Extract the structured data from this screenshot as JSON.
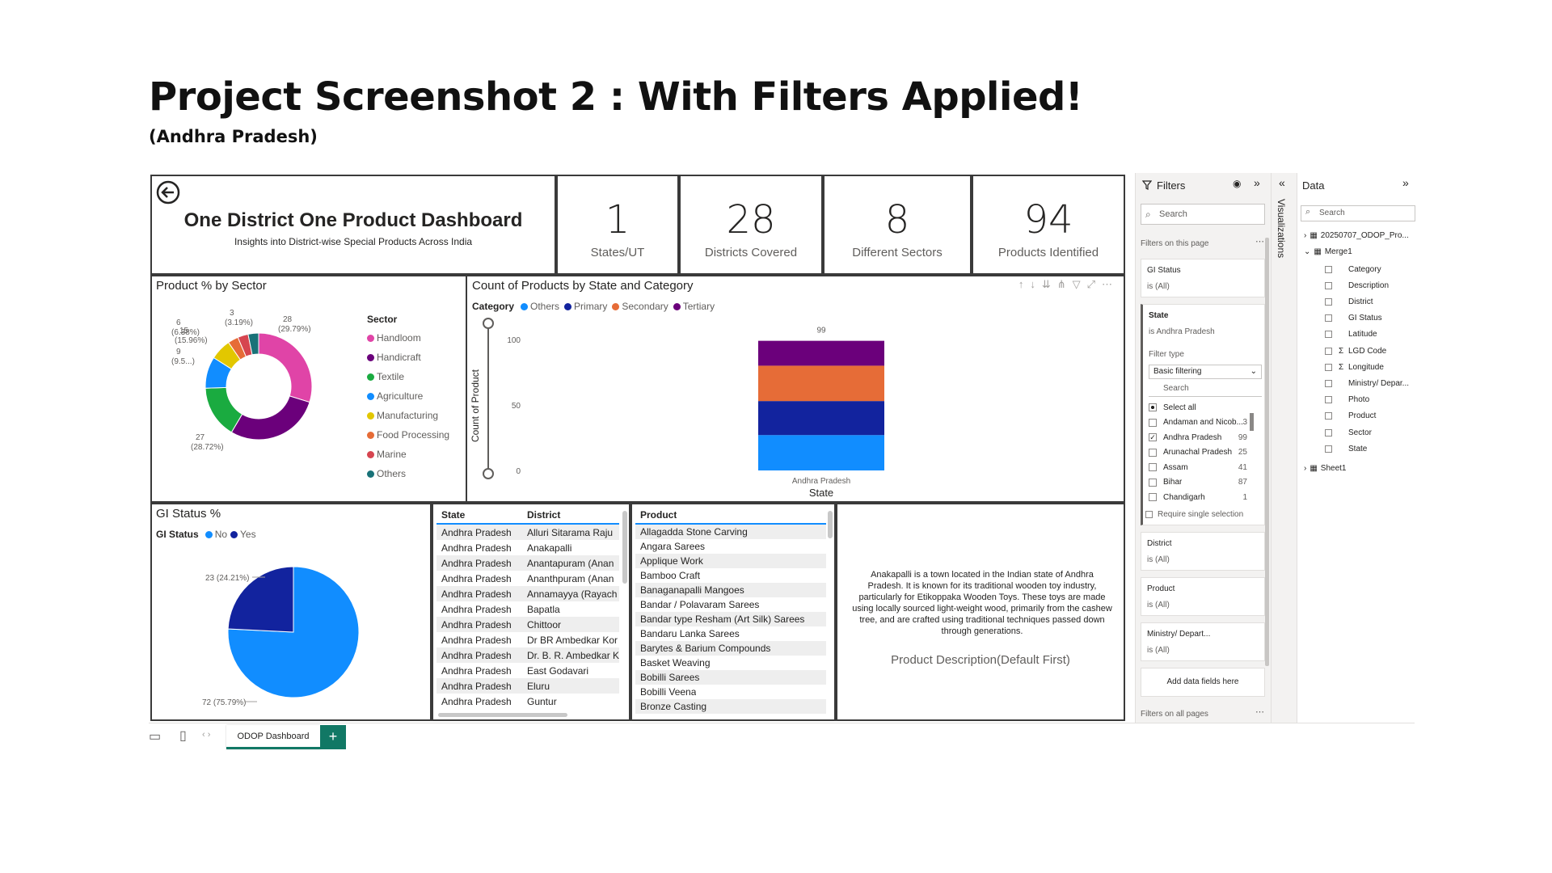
{
  "slide": {
    "title": "Project Screenshot 2 : With Filters Applied!",
    "subtitle": "(Andhra Pradesh)"
  },
  "header": {
    "title": "One District One Product Dashboard",
    "subtitle": "Insights into District-wise Special Products Across India"
  },
  "kpis": [
    {
      "value": "1",
      "label": "States/UT"
    },
    {
      "value": "28",
      "label": "Districts Covered"
    },
    {
      "value": "8",
      "label": "Different Sectors"
    },
    {
      "value": "94",
      "label": "Products Identified"
    }
  ],
  "chart_data": [
    {
      "type": "pie",
      "title": "Product % by Sector",
      "legend_title": "Sector",
      "legend_position": "right",
      "slices": [
        {
          "name": "Handloom",
          "value": 28,
          "label": "28 (29.79%)",
          "color": "#e044a7"
        },
        {
          "name": "Handicraft",
          "value": 27,
          "label": "27 (28.72%)",
          "color": "#6b007b"
        },
        {
          "name": "Textile",
          "value": 15,
          "label": "15 (15.96%)",
          "color": "#1aab40"
        },
        {
          "name": "Agriculture",
          "value": 9,
          "label": "9 (9.5...)",
          "color": "#118dff"
        },
        {
          "name": "Manufacturing",
          "value": 6,
          "label": "6 (6.38%)",
          "color": "#e2c700"
        },
        {
          "name": "Food Processing",
          "value": 3,
          "label": "3 (3.19%)",
          "color": "#e66c37"
        },
        {
          "name": "Marine",
          "value": 3,
          "label": "",
          "color": "#d64550"
        },
        {
          "name": "Others",
          "value": 3,
          "label": "",
          "color": "#197278"
        }
      ]
    },
    {
      "type": "bar",
      "title": "Count of Products by State and Category",
      "legend_title": "Category",
      "xlabel": "State",
      "ylabel": "Count of Product",
      "categories": [
        "Andhra Pradesh"
      ],
      "ylim": [
        0,
        100
      ],
      "yticks": [
        "0",
        "50",
        "100"
      ],
      "total_label": "99",
      "series": [
        {
          "name": "Others",
          "values": [
            27
          ],
          "color": "#118dff"
        },
        {
          "name": "Primary",
          "values": [
            26
          ],
          "color": "#12239e"
        },
        {
          "name": "Secondary",
          "values": [
            27
          ],
          "color": "#e66c37"
        },
        {
          "name": "Tertiary",
          "values": [
            19
          ],
          "color": "#6b007b"
        }
      ]
    },
    {
      "type": "pie",
      "title": "GI Status %",
      "legend_title": "GI Status",
      "legend_position": "top-left",
      "slices": [
        {
          "name": "No",
          "value": 72,
          "label": "72 (75.79%)",
          "color": "#118dff"
        },
        {
          "name": "Yes",
          "value": 23,
          "label": "23 (24.21%)",
          "color": "#12239e"
        }
      ]
    }
  ],
  "state_table": {
    "headers": [
      "State",
      "District"
    ],
    "rows": [
      [
        "Andhra Pradesh",
        "Alluri Sitarama Raju"
      ],
      [
        "Andhra Pradesh",
        "Anakapalli"
      ],
      [
        "Andhra Pradesh",
        "Anantapuram (Anan"
      ],
      [
        "Andhra Pradesh",
        "Ananthpuram (Anan"
      ],
      [
        "Andhra Pradesh",
        "Annamayya (Rayach"
      ],
      [
        "Andhra Pradesh",
        "Bapatla"
      ],
      [
        "Andhra Pradesh",
        "Chittoor"
      ],
      [
        "Andhra Pradesh",
        "Dr BR Ambedkar Kor"
      ],
      [
        "Andhra Pradesh",
        "Dr. B. R. Ambedkar K"
      ],
      [
        "Andhra Pradesh",
        "East Godavari"
      ],
      [
        "Andhra Pradesh",
        "Eluru"
      ],
      [
        "Andhra Pradesh",
        "Guntur"
      ]
    ]
  },
  "product_table": {
    "header": "Product",
    "rows": [
      "Allagadda Stone Carving",
      "Angara Sarees",
      "Applique Work",
      "Bamboo Craft",
      "Banaganapalli Mangoes",
      "Bandar / Polavaram Sarees",
      "Bandar type Resham (Art Silk) Sarees",
      "Bandaru Lanka Sarees",
      "Barytes & Barium Compounds",
      "Basket Weaving",
      "Bobilli Sarees",
      "Bobilli Veena",
      "Bronze Casting"
    ]
  },
  "description": {
    "text": "Anakapalli is a town located in the Indian state of Andhra Pradesh. It is known for its traditional wooden toy industry, particularly for Etikoppaka Wooden Toys. These toys are made using locally sourced light-weight wood, primarily from the cashew tree, and are crafted using traditional techniques passed down through generations.",
    "label": "Product Description(Default First)"
  },
  "filters_pane": {
    "title": "Filters",
    "search": "Search",
    "on_this_page": "Filters on this page",
    "gi": {
      "name": "GI Status",
      "value": "is (All)"
    },
    "state": {
      "name": "State",
      "value": "is Andhra Pradesh",
      "filter_type_label": "Filter type",
      "filter_type": "Basic filtering",
      "search": "Search",
      "require_single": "Require single selection",
      "items": [
        {
          "name": "Select all",
          "count": ""
        },
        {
          "name": "Andaman and Nicob...",
          "count": "3"
        },
        {
          "name": "Andhra Pradesh",
          "count": "99"
        },
        {
          "name": "Arunachal Pradesh",
          "count": "25"
        },
        {
          "name": "Assam",
          "count": "41"
        },
        {
          "name": "Bihar",
          "count": "87"
        },
        {
          "name": "Chandigarh",
          "count": "1"
        }
      ]
    },
    "district": {
      "name": "District",
      "value": "is (All)"
    },
    "product": {
      "name": "Product",
      "value": "is (All)"
    },
    "ministry": {
      "name": "Ministry/ Depart...",
      "value": "is (All)"
    },
    "add_fields": "Add data fields here",
    "on_all_pages": "Filters on all pages"
  },
  "viz_pane": {
    "title": "Visualizations"
  },
  "data_pane": {
    "title": "Data",
    "search": "Search",
    "tables": [
      "20250707_ODOP_Pro...",
      "Merge1",
      "Sheet1"
    ],
    "fields": [
      {
        "name": "Category",
        "sigma": false
      },
      {
        "name": "Description",
        "sigma": false
      },
      {
        "name": "District",
        "sigma": false
      },
      {
        "name": "GI Status",
        "sigma": false
      },
      {
        "name": "Latitude",
        "sigma": false
      },
      {
        "name": "LGD Code",
        "sigma": true
      },
      {
        "name": "Longitude",
        "sigma": true
      },
      {
        "name": "Ministry/ Depar...",
        "sigma": false
      },
      {
        "name": "Photo",
        "sigma": false
      },
      {
        "name": "Product",
        "sigma": false
      },
      {
        "name": "Sector",
        "sigma": false
      },
      {
        "name": "State",
        "sigma": false
      }
    ]
  },
  "tabbar": {
    "tab": "ODOP Dashboard",
    "add": "+"
  }
}
